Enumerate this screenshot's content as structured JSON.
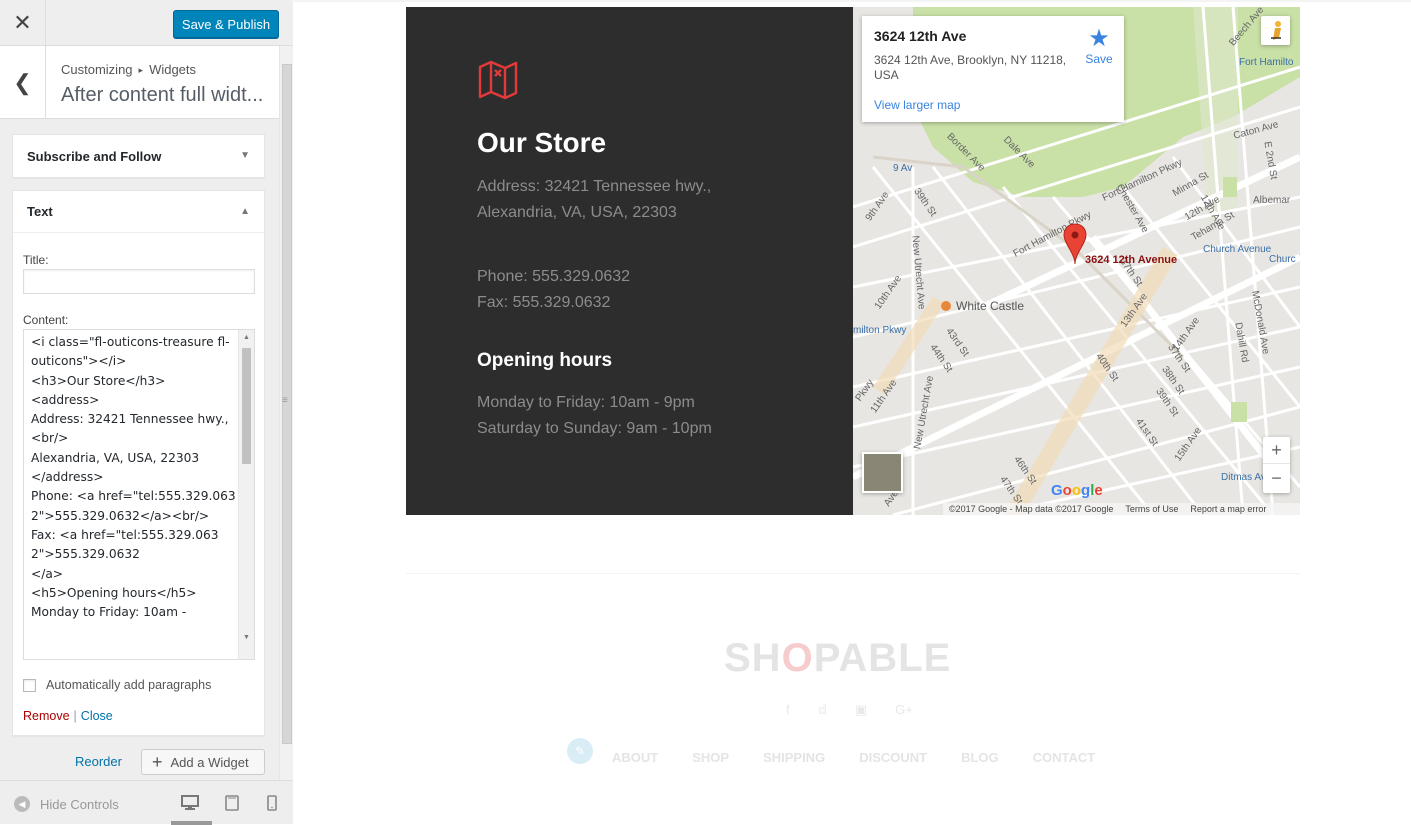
{
  "toolbar": {
    "close_icon": "close-icon",
    "publish_label": "Save & Publish"
  },
  "section": {
    "crumb_root": "Customizing",
    "crumb_child": "Widgets",
    "title": "After content full widt..."
  },
  "widgets": {
    "subscribe": {
      "title": "Subscribe and Follow"
    },
    "text": {
      "title": "Text",
      "title_label": "Title:",
      "title_value": "",
      "content_label": "Content:",
      "content_value": "<i class=\"fl-outicons-treasure fl-outicons\"></i>\n<h3>Our Store</h3>\n<address>\nAddress: 32421 Tennessee hwy.,<br/>\nAlexandria, VA, USA, 22303\n</address>\nPhone: <a href=\"tel:555.329.0632\">555.329.0632</a><br/>\nFax: <a href=\"tel:555.329.0632\">555.329.0632\n</a>\n<h5>Opening hours</h5>\nMonday to Friday: 10am -",
      "auto_paragraphs_label": "Automatically add paragraphs",
      "auto_paragraphs_checked": false,
      "remove_label": "Remove",
      "close_label": "Close"
    },
    "reorder_label": "Reorder",
    "add_widget_label": "Add a Widget"
  },
  "footer": {
    "hide_controls_label": "Hide Controls",
    "active_device": "desktop"
  },
  "store": {
    "title": "Our Store",
    "address_line1": "Address: 32421 Tennessee hwy.,",
    "address_line2": "Alexandria, VA, USA, 22303",
    "phone": "Phone: 555.329.0632",
    "fax": "Fax: 555.329.0632",
    "hours_title": "Opening hours",
    "hours_weekday": "Monday to Friday: 10am - 9pm",
    "hours_weekend": "Saturday to Sunday: 9am - 10pm",
    "accent_color": "#e23a3a"
  },
  "map": {
    "place_name": "3624 12th Ave",
    "place_address": "3624 12th Ave, Brooklyn, NY 11218, USA",
    "save_label": "Save",
    "larger_map_label": "View larger map",
    "pin_label": "3624 12th Avenue",
    "poi_label": "White Castle",
    "streets": [
      "Fort Hamilton Pkwy",
      "Caton Ave",
      "E 2nd St",
      "Albemar",
      "Minna St",
      "12th Ave",
      "Tehama St",
      "Church Avenue",
      "Churc",
      "McDonald Ave",
      "Dahill Rd",
      "37th St",
      "13th Ave",
      "40th St",
      "14th Ave",
      "37th St",
      "38th St",
      "39th St",
      "41st St",
      "15th Ave",
      "Ditmas Ave",
      "46th St",
      "47th St",
      "New Utrecht Ave",
      "10th Ave",
      "11th Ave",
      "43rd St",
      "44th St",
      "9th Ave",
      "39th St",
      "Dale Ave",
      "Border Ave",
      "Chester Ave",
      "9 Av",
      "milton Pkwy",
      "Pkwy",
      "Ave",
      "Beech Ave",
      "Fort Hamilto",
      "12th Ave",
      "New Utrecht Ave"
    ],
    "zoom_in": "+",
    "zoom_out": "−",
    "google_logo": "Google",
    "attribution": "©2017 Google - Map data ©2017 Google",
    "terms": "Terms of Use",
    "report": "Report a map error"
  },
  "site_footer": {
    "logo_prefix": "SH",
    "logo_o": "O",
    "logo_suffix": "PABLE",
    "social_icons": [
      "facebook-icon",
      "twitter-icon",
      "instagram-icon",
      "google-plus-icon"
    ],
    "menu": [
      "ABOUT",
      "SHOP",
      "SHIPPING",
      "DISCOUNT",
      "BLOG",
      "CONTACT"
    ]
  }
}
